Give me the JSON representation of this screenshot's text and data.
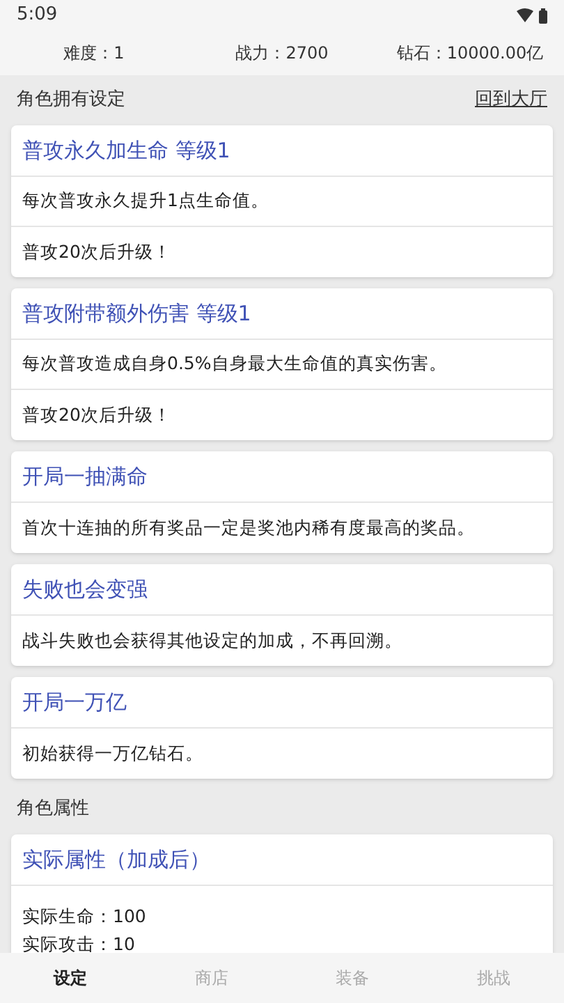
{
  "status_bar": {
    "time": "5:09"
  },
  "stats": [
    "难度：1",
    "战力：2700",
    "钻石：10000.00亿"
  ],
  "section": {
    "title": "角色拥有设定",
    "link": "回到大厅"
  },
  "cards": [
    {
      "title": "普攻永久加生命 等级1",
      "lines": [
        "每次普攻永久提升1点生命值。",
        "普攻20次后升级！"
      ]
    },
    {
      "title": "普攻附带额外伤害 等级1",
      "lines": [
        "每次普攻造成自身0.5%自身最大生命值的真实伤害。",
        "普攻20次后升级！"
      ]
    },
    {
      "title": "开局一抽满命",
      "lines": [
        "首次十连抽的所有奖品一定是奖池内稀有度最高的奖品。"
      ]
    },
    {
      "title": "失败也会变强",
      "lines": [
        "战斗失败也会获得其他设定的加成，不再回溯。"
      ]
    },
    {
      "title": "开局一万亿",
      "lines": [
        "初始获得一万亿钻石。"
      ]
    }
  ],
  "attributes": {
    "title": "角色属性",
    "card_title": "实际属性（加成后）",
    "lines": [
      "实际生命：100",
      "实际攻击：10"
    ]
  },
  "tabs": [
    {
      "label": "设定",
      "selected": true
    },
    {
      "label": "商店",
      "selected": false
    },
    {
      "label": "装备",
      "selected": false
    },
    {
      "label": "挑战",
      "selected": false
    }
  ]
}
